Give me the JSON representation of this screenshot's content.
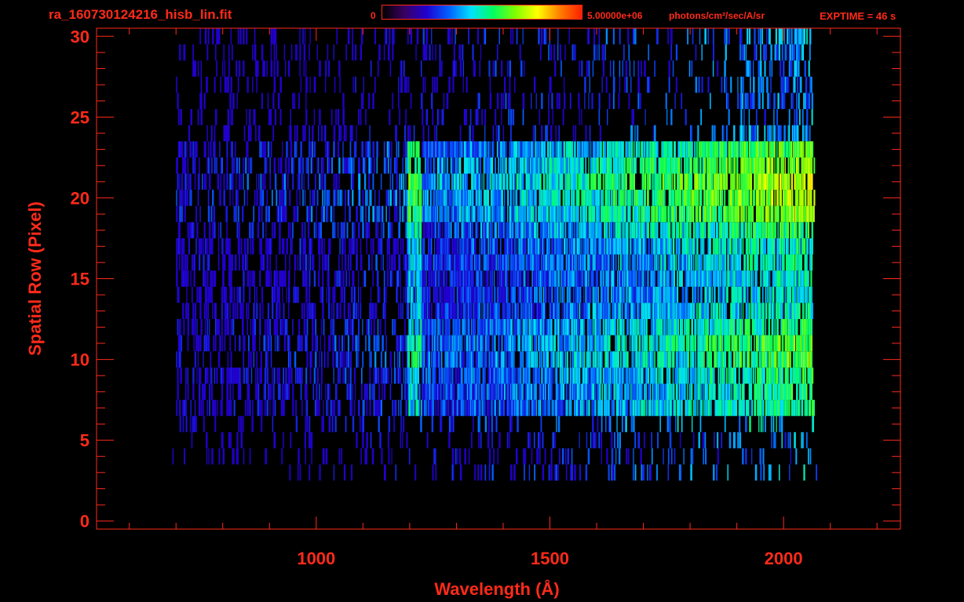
{
  "header": {
    "filename": "ra_160730124216_hisb_lin.fit",
    "colorbar_min": "0",
    "colorbar_max": "5.00000e+06",
    "colorbar_units": "photons/cm²/sec/A/sr",
    "exptime": "EXPTIME = 46 s"
  },
  "colors": {
    "axis": "#ff2a1a",
    "background": "#000000",
    "colormap": [
      "#000000",
      "#3a0060",
      "#2000d0",
      "#0060ff",
      "#00e0ff",
      "#00ff60",
      "#80ff00",
      "#ffff00",
      "#ff8000",
      "#ff2000"
    ]
  },
  "chart_data": {
    "type": "heatmap",
    "title": "ra_160730124216_hisb_lin.fit",
    "xlabel": "Wavelength (Å)",
    "ylabel": "Spatial Row (Pixel)",
    "xlim": [
      530,
      2250
    ],
    "ylim": [
      -0.5,
      30.5
    ],
    "x_ticks": [
      1000,
      1500,
      2000
    ],
    "y_ticks": [
      0,
      5,
      10,
      15,
      20,
      25,
      30
    ],
    "colorbar": {
      "min": 0,
      "max": 5000000,
      "units": "photons/cm²/sec/A/sr"
    },
    "grid": false,
    "rows": [
      {
        "row": 2,
        "x_range": [
          2055,
          2070
        ],
        "level": 0.72
      },
      {
        "row": 3,
        "x_range": [
          850,
          2070
        ],
        "level": 0.45
      },
      {
        "row": 4,
        "x_range": [
          690,
          2060
        ],
        "level": 0.4
      },
      {
        "row": 5,
        "x_range": [
          680,
          2065
        ],
        "level": 0.42
      },
      {
        "row": 6,
        "x_range": [
          690,
          2065
        ],
        "level": 0.55
      },
      {
        "row": 7,
        "x_range": [
          700,
          2065
        ],
        "level": 0.62
      },
      {
        "row": 8,
        "x_range": [
          700,
          2060
        ],
        "level": 0.62
      },
      {
        "row": 9,
        "x_range": [
          700,
          2060
        ],
        "level": 0.64
      },
      {
        "row": 10,
        "x_range": [
          700,
          2060
        ],
        "level": 0.7
      },
      {
        "row": 11,
        "x_range": [
          700,
          2060
        ],
        "level": 0.72
      },
      {
        "row": 12,
        "x_range": [
          700,
          2060
        ],
        "level": 0.66
      },
      {
        "row": 13,
        "x_range": [
          700,
          2060
        ],
        "level": 0.58
      },
      {
        "row": 14,
        "x_range": [
          700,
          2060
        ],
        "level": 0.55
      },
      {
        "row": 15,
        "x_range": [
          700,
          2060
        ],
        "level": 0.56
      },
      {
        "row": 16,
        "x_range": [
          700,
          2060
        ],
        "level": 0.58
      },
      {
        "row": 17,
        "x_range": [
          700,
          2060
        ],
        "level": 0.6
      },
      {
        "row": 18,
        "x_range": [
          700,
          2065
        ],
        "level": 0.68
      },
      {
        "row": 19,
        "x_range": [
          700,
          2065
        ],
        "level": 0.78
      },
      {
        "row": 20,
        "x_range": [
          700,
          2065
        ],
        "level": 0.82
      },
      {
        "row": 21,
        "x_range": [
          700,
          2065
        ],
        "level": 0.84
      },
      {
        "row": 22,
        "x_range": [
          700,
          2065
        ],
        "level": 0.8
      },
      {
        "row": 23,
        "x_range": [
          700,
          2060
        ],
        "level": 0.72
      },
      {
        "row": 24,
        "x_range": [
          700,
          2060
        ],
        "level": 0.45
      },
      {
        "row": 25,
        "x_range": [
          700,
          2060
        ],
        "level": 0.42
      },
      {
        "row": 26,
        "x_range": [
          700,
          2060
        ],
        "level": 0.4
      },
      {
        "row": 27,
        "x_range": [
          700,
          2060
        ],
        "level": 0.4
      },
      {
        "row": 28,
        "x_range": [
          700,
          2060
        ],
        "level": 0.4
      },
      {
        "row": 29,
        "x_range": [
          700,
          2060
        ],
        "level": 0.42
      },
      {
        "row": 30,
        "x_range": [
          700,
          2060
        ],
        "level": 0.45
      }
    ]
  }
}
